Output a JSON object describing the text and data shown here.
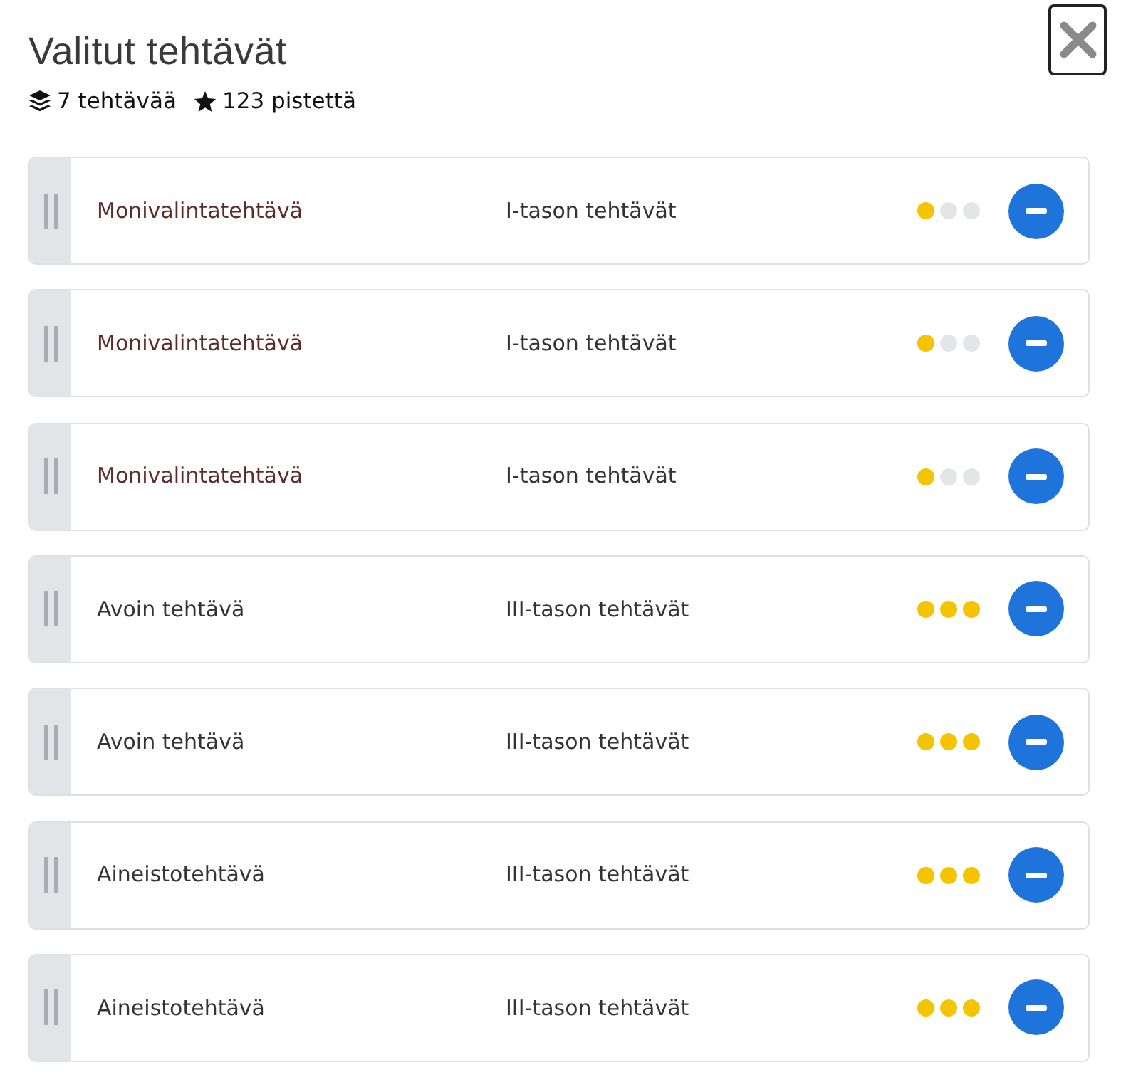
{
  "header": {
    "title": "Valitut tehtävät",
    "task_count": "7 tehtävää",
    "points": "123 pistettä"
  },
  "tasks": [
    {
      "name": "Monivalintatehtävä",
      "color": "#5c2b2b",
      "category": "I-tason tehtävät",
      "stars": 1
    },
    {
      "name": "Monivalintatehtävä",
      "color": "#5c2b2b",
      "category": "I-tason tehtävät",
      "stars": 1
    },
    {
      "name": "Monivalintatehtävä",
      "color": "#5c2b2b",
      "category": "I-tason tehtävät",
      "stars": 1
    },
    {
      "name": "Avoin tehtävä",
      "color": "#333333",
      "category": "III-tason tehtävät",
      "stars": 3
    },
    {
      "name": "Avoin tehtävä",
      "color": "#333333",
      "category": "III-tason tehtävät",
      "stars": 3
    },
    {
      "name": "Aineistotehtävä",
      "color": "#333333",
      "category": "III-tason tehtävät",
      "stars": 3
    },
    {
      "name": "Aineistotehtävä",
      "color": "#333333",
      "category": "III-tason tehtävät",
      "stars": 3
    }
  ]
}
